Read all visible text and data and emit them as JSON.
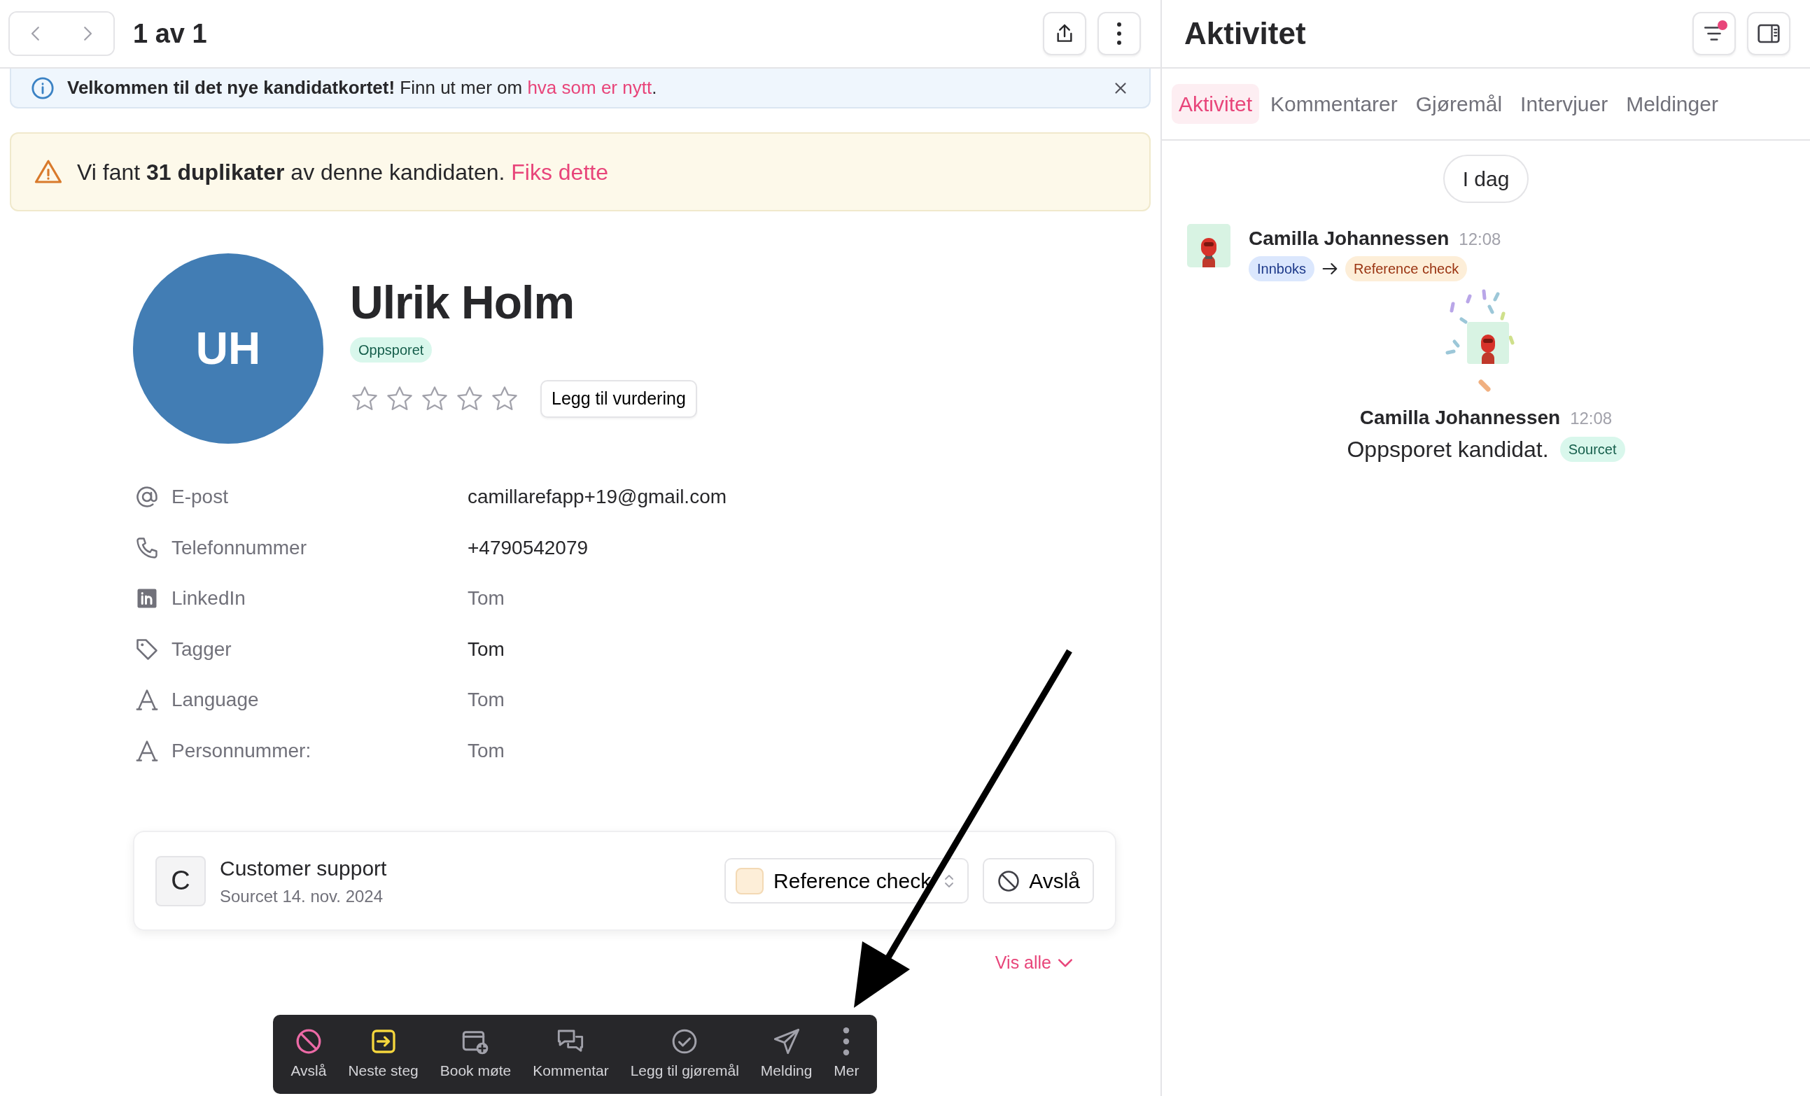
{
  "header": {
    "pager": "1 av 1"
  },
  "info_banner": {
    "text": "**Velkommen til det nye kandidatkortet!** Finn ut mer om ",
    "link": "hva som er nytt",
    "suffix": "."
  },
  "warning": {
    "text": "Vi fant **31 duplikater** av denne kandidaten. ",
    "link": "Fiks dette"
  },
  "candidate": {
    "initials": "UH",
    "name": "Ulrik Holm",
    "status": "Oppsporet",
    "stars": 0,
    "rate_button": "Legg til vurdering"
  },
  "fields": [
    {
      "kind": "email",
      "label": "E-post",
      "value": "camillarefapp+19@gmail.com",
      "empty": false
    },
    {
      "kind": "phone",
      "label": "Telefonnummer",
      "value": "+4790542079",
      "empty": false
    },
    {
      "kind": "linkedin",
      "label": "LinkedIn",
      "value": "Tom",
      "empty": true
    },
    {
      "kind": "tag",
      "label": "Tagger",
      "value": "Tom",
      "empty": false
    },
    {
      "kind": "text",
      "label": "Language",
      "value": "Tom",
      "empty": true
    },
    {
      "kind": "text",
      "label": "Personnummer:",
      "value": "Tom",
      "empty": true
    }
  ],
  "application": {
    "initial": "C",
    "title": "Customer support",
    "subtitle": "Sourcet 14. nov. 2024",
    "stage": "Reference check",
    "reject": "Avslå"
  },
  "show_all": "Vis alle",
  "toolbar": [
    {
      "kind": "reject",
      "label": "Avslå"
    },
    {
      "kind": "next",
      "label": "Neste steg"
    },
    {
      "kind": "meeting",
      "label": "Book møte"
    },
    {
      "kind": "comment",
      "label": "Kommentar"
    },
    {
      "kind": "todo",
      "label": "Legg til gjøremål"
    },
    {
      "kind": "message",
      "label": "Melding"
    },
    {
      "kind": "more",
      "label": "Mer"
    }
  ],
  "activity": {
    "title": "Aktivitet",
    "filter_active": true,
    "tabs": [
      {
        "label": "Aktivitet",
        "selected": true
      },
      {
        "label": "Kommentarer",
        "selected": false
      },
      {
        "label": "Gjøremål",
        "selected": false
      },
      {
        "label": "Intervjuer",
        "selected": false
      },
      {
        "label": "Meldinger",
        "selected": false
      }
    ],
    "day": "I dag",
    "events": [
      {
        "kind": "stage_change",
        "author": "Camilla Johannessen",
        "time": "12:08",
        "from": "Innboks",
        "to": "Reference check"
      },
      {
        "kind": "sourced",
        "author": "Camilla Johannessen",
        "time": "12:08",
        "text": "Oppsporet kandidat.",
        "tag": "Sourcet"
      }
    ]
  }
}
